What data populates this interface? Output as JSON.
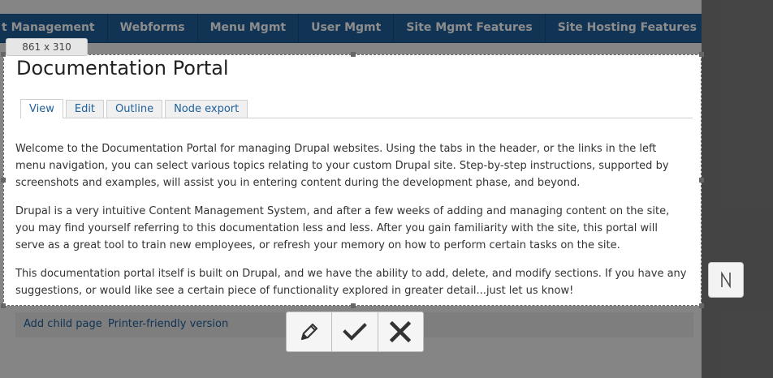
{
  "nav": {
    "items": [
      "t Management",
      "Webforms",
      "Menu Mgmt",
      "User Mgmt",
      "Site Mgmt Features",
      "Site Hosting Features"
    ]
  },
  "selection": {
    "size_label": "861 x 310"
  },
  "page": {
    "title": "Documentation Portal",
    "tabs": [
      "View",
      "Edit",
      "Outline",
      "Node export"
    ],
    "paragraphs": [
      "Welcome to the Documentation Portal for managing Drupal websites.  Using the tabs in the header, or the links in the left menu navigation, you can select various topics relating to your custom Drupal site.  Step-by-step instructions, supported by screenshots and examples, will assist you in entering content during the development phase, and beyond.",
      "Drupal is a very intuitive Content Management System, and after a few weeks of adding and managing content on the site, you may find yourself referring to this documentation less and less.  After you gain familiarity with the site, this portal will serve as a great tool to train new employees, or refresh your memory on how to perform certain tasks on the site.",
      "This documentation portal itself is built on Drupal, and we have the ability to add, delete, and modify sections.  If you have any suggestions, or would like see a certain piece of functionality explored in greater detail...just let us know!"
    ]
  },
  "links": {
    "add_child": "Add child page",
    "printer": "Printer-friendly version"
  },
  "toolbar": {
    "icons": [
      "pencil-icon",
      "checkmark-icon",
      "close-icon"
    ]
  },
  "side_button": {
    "icon": "cursor-icon"
  },
  "colors": {
    "nav_bg": "#1f5f9b",
    "link": "#1f5f9b"
  }
}
